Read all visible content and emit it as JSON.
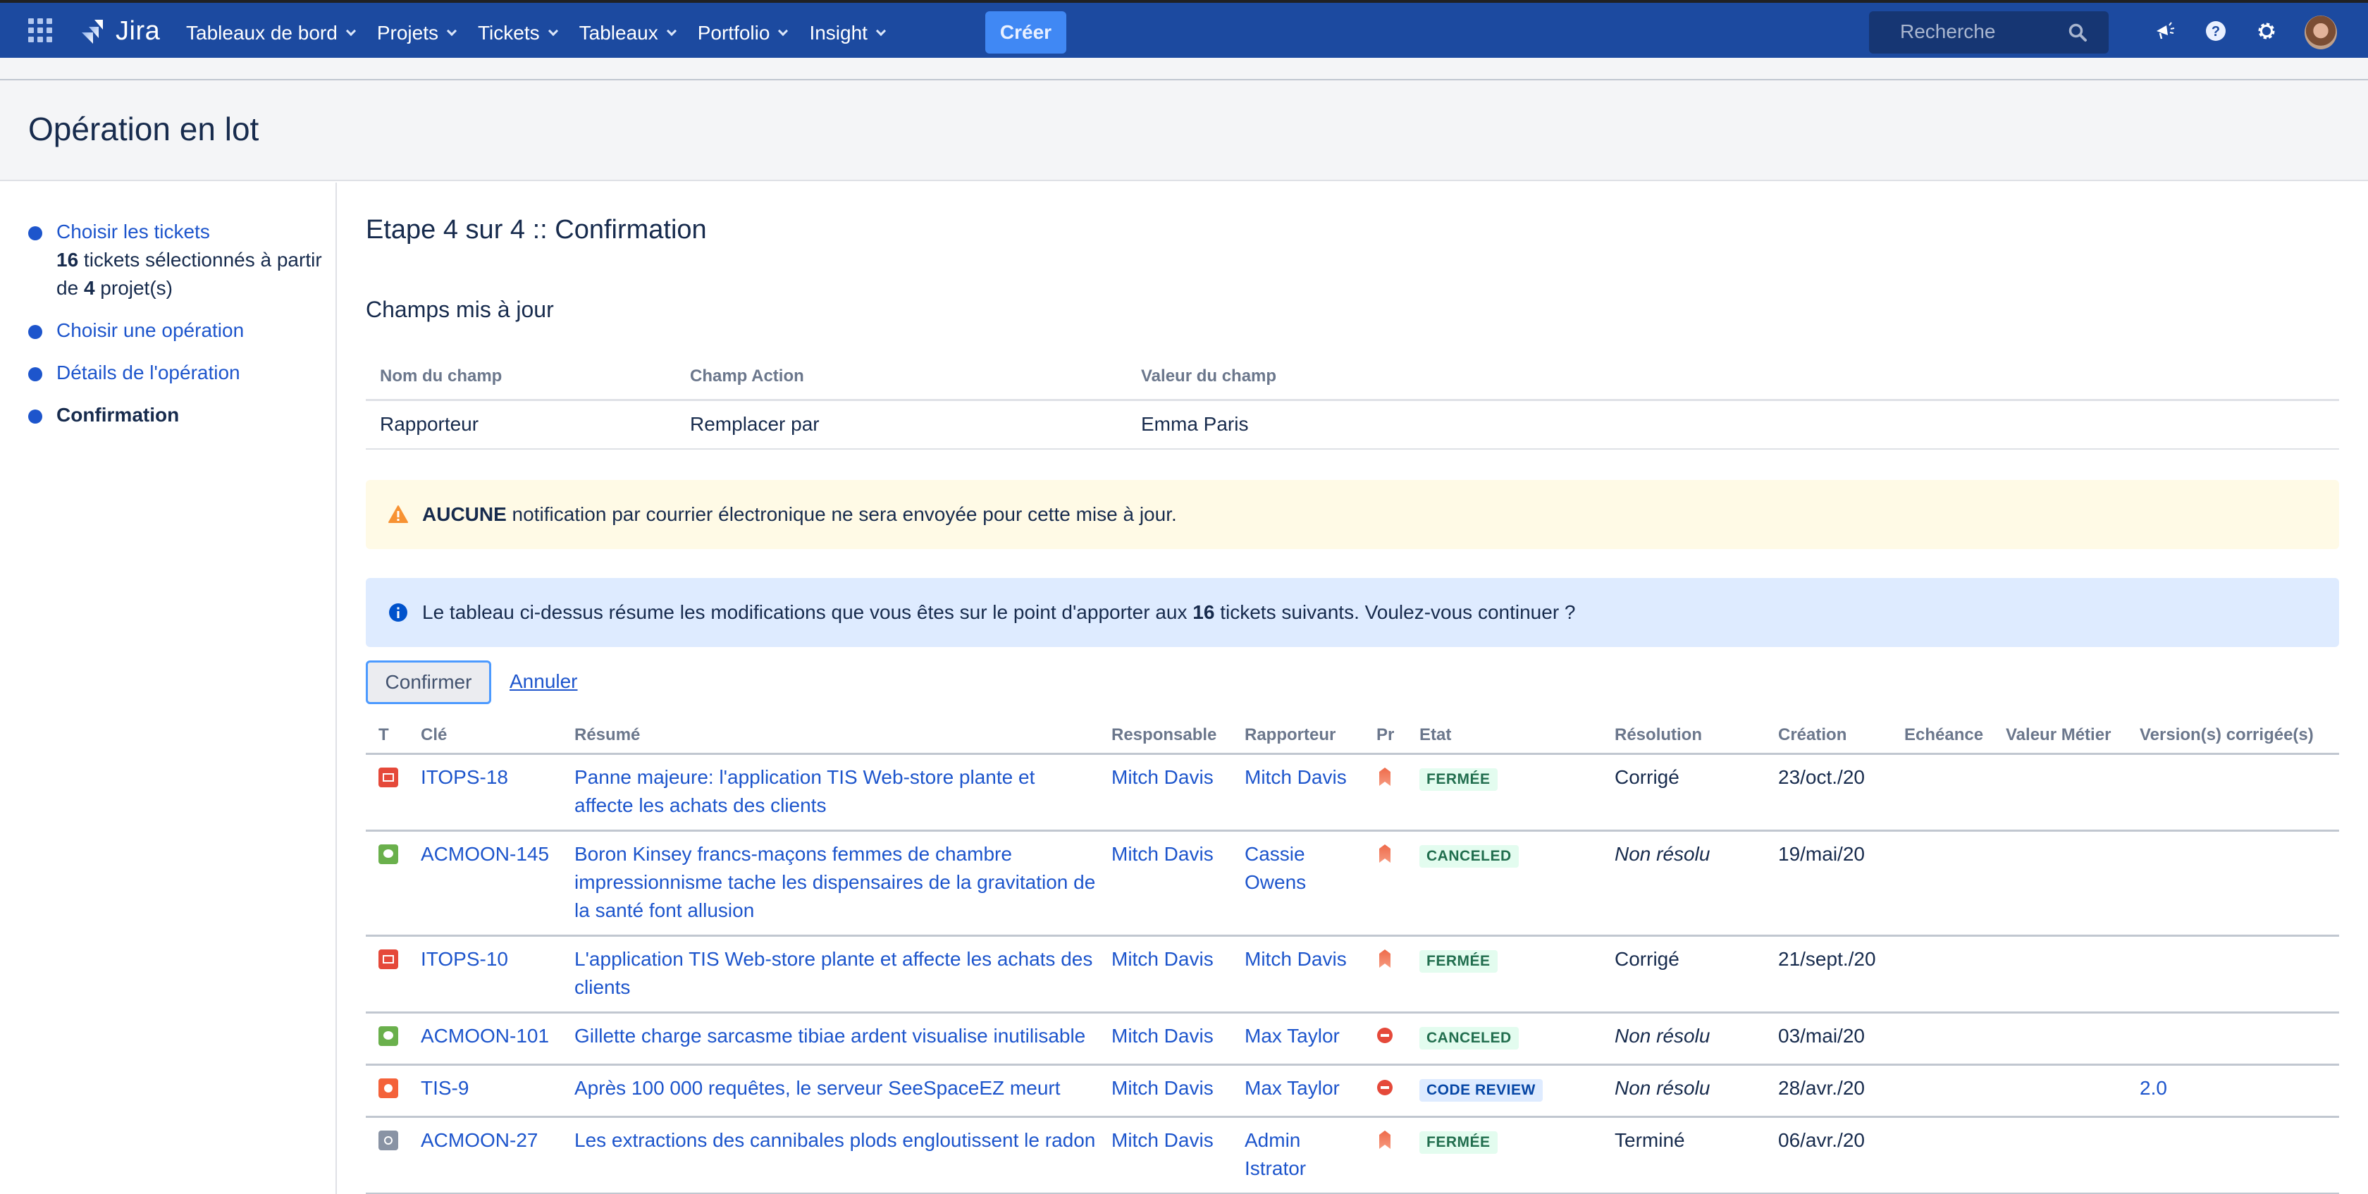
{
  "nav": {
    "logo_text": "Jira",
    "menu": [
      {
        "label": "Tableaux de bord"
      },
      {
        "label": "Projets"
      },
      {
        "label": "Tickets"
      },
      {
        "label": "Tableaux"
      },
      {
        "label": "Portfolio"
      },
      {
        "label": "Insight"
      }
    ],
    "create_label": "Créer",
    "search_placeholder": "Recherche",
    "icons": [
      "apps-grid-icon",
      "jira-logo-icon",
      "search-icon",
      "megaphone-icon",
      "help-icon",
      "gear-icon",
      "avatar"
    ]
  },
  "page": {
    "title": "Opération en lot"
  },
  "sidebar": {
    "steps": [
      {
        "label": "Choisir les tickets",
        "state": "done",
        "sub": {
          "count": "16",
          "text1": " tickets sélectionnés à partir de ",
          "projects": "4",
          "text2": " projet(s)"
        }
      },
      {
        "label": "Choisir une opération",
        "state": "done"
      },
      {
        "label": "Détails de l'opération",
        "state": "done"
      },
      {
        "label": "Confirmation",
        "state": "current"
      }
    ]
  },
  "main": {
    "step_title": "Etape 4 sur 4 :: Confirmation",
    "section_title": "Champs mis à jour",
    "fields_table": {
      "headers": [
        "Nom du champ",
        "Champ Action",
        "Valeur du champ"
      ],
      "rows": [
        [
          "Rapporteur",
          "Remplacer par",
          "Emma Paris"
        ]
      ]
    },
    "warning": {
      "bold": "AUCUNE",
      "text": " notification par courrier électronique ne sera envoyée pour cette mise à jour."
    },
    "info": {
      "text1": "Le tableau ci-dessus résume les modifications que vous êtes sur le point d'apporter aux ",
      "count": "16",
      "text2": " tickets suivants. Voulez-vous continuer ?"
    },
    "confirm_label": "Confirmer",
    "cancel_label": "Annuler",
    "issues": {
      "headers": [
        "T",
        "Clé",
        "Résumé",
        "Responsable",
        "Rapporteur",
        "Pr",
        "Etat",
        "Résolution",
        "Création",
        "Echéance",
        "Valeur Métier",
        "Version(s) corrigée(s)"
      ],
      "rows": [
        {
          "type": "incident",
          "key": "ITOPS-18",
          "summary": "Panne majeure: l'application TIS Web-store plante et affecte les achats des clients",
          "assignee": "Mitch Davis",
          "reporter": "Mitch Davis",
          "priority": "high",
          "status": "FERMÉE",
          "status_color": "green",
          "resolution": "Corrigé",
          "resolution_unresolved": false,
          "created": "23/oct./20",
          "due": "",
          "business_value": "",
          "fix_versions": ""
        },
        {
          "type": "feedback",
          "key": "ACMOON-145",
          "summary": "Boron Kinsey francs-maçons femmes de chambre impressionnisme tache les dispensaires de la gravitation de la santé font allusion",
          "assignee": "Mitch Davis",
          "reporter": "Cassie Owens",
          "priority": "high",
          "status": "CANCELED",
          "status_color": "green",
          "resolution": "Non résolu",
          "resolution_unresolved": true,
          "created": "19/mai/20",
          "due": "",
          "business_value": "",
          "fix_versions": ""
        },
        {
          "type": "incident",
          "key": "ITOPS-10",
          "summary": "L'application TIS Web-store plante et affecte les achats des clients",
          "assignee": "Mitch Davis",
          "reporter": "Mitch Davis",
          "priority": "high",
          "status": "FERMÉE",
          "status_color": "green",
          "resolution": "Corrigé",
          "resolution_unresolved": false,
          "created": "21/sept./20",
          "due": "",
          "business_value": "",
          "fix_versions": ""
        },
        {
          "type": "feedback",
          "key": "ACMOON-101",
          "summary": "Gillette charge sarcasme tibiae ardent visualise inutilisable",
          "assignee": "Mitch Davis",
          "reporter": "Max Taylor",
          "priority": "blocker",
          "status": "CANCELED",
          "status_color": "green",
          "resolution": "Non résolu",
          "resolution_unresolved": true,
          "created": "03/mai/20",
          "due": "",
          "business_value": "",
          "fix_versions": ""
        },
        {
          "type": "bug",
          "key": "TIS-9",
          "summary": "Après 100 000 requêtes, le serveur SeeSpaceEZ meurt",
          "assignee": "Mitch Davis",
          "reporter": "Max Taylor",
          "priority": "blocker",
          "status": "CODE REVIEW",
          "status_color": "blue",
          "resolution": "Non résolu",
          "resolution_unresolved": true,
          "created": "28/avr./20",
          "due": "",
          "business_value": "",
          "fix_versions": "2.0"
        },
        {
          "type": "task",
          "key": "ACMOON-27",
          "summary": "Les extractions des cannibales plods engloutissent le radon",
          "assignee": "Mitch Davis",
          "reporter": "Admin Istrator",
          "priority": "high",
          "status": "FERMÉE",
          "status_color": "green",
          "resolution": "Terminé",
          "resolution_unresolved": false,
          "created": "06/avr./20",
          "due": "",
          "business_value": "",
          "fix_versions": ""
        }
      ]
    }
  },
  "colors": {
    "nav_bg": "#1c4aa0",
    "create_btn": "#4088f4",
    "link": "#1d55cc",
    "warning_bg": "#fffae6",
    "info_bg": "#deebff",
    "priority_high": "#f0714f",
    "priority_blocker": "#e5493a"
  }
}
